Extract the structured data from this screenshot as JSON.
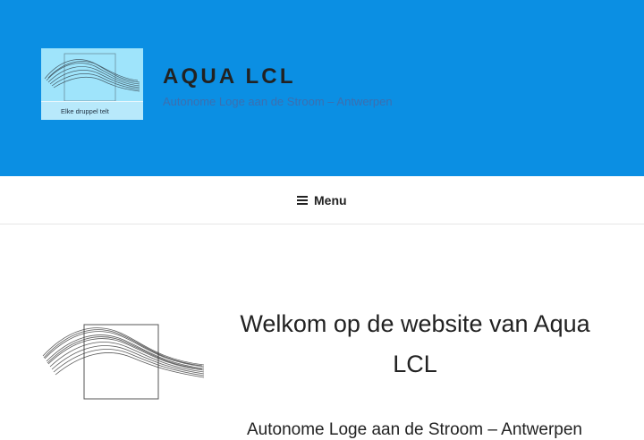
{
  "header": {
    "logo_caption": "Elke druppel telt",
    "site_title": "AQUA LCL",
    "tagline": "Autonome Loge aan de Stroom – Antwerpen"
  },
  "nav": {
    "menu_label": "Menu"
  },
  "content": {
    "welcome_title": "Welkom op de website van Aqua LCL",
    "subtext": "Autonome Loge aan de Stroom – Antwerpen"
  },
  "colors": {
    "header_bg": "#0b8fe3",
    "logo_bg": "#9fe4fb",
    "tagline": "#3b6fb0"
  }
}
